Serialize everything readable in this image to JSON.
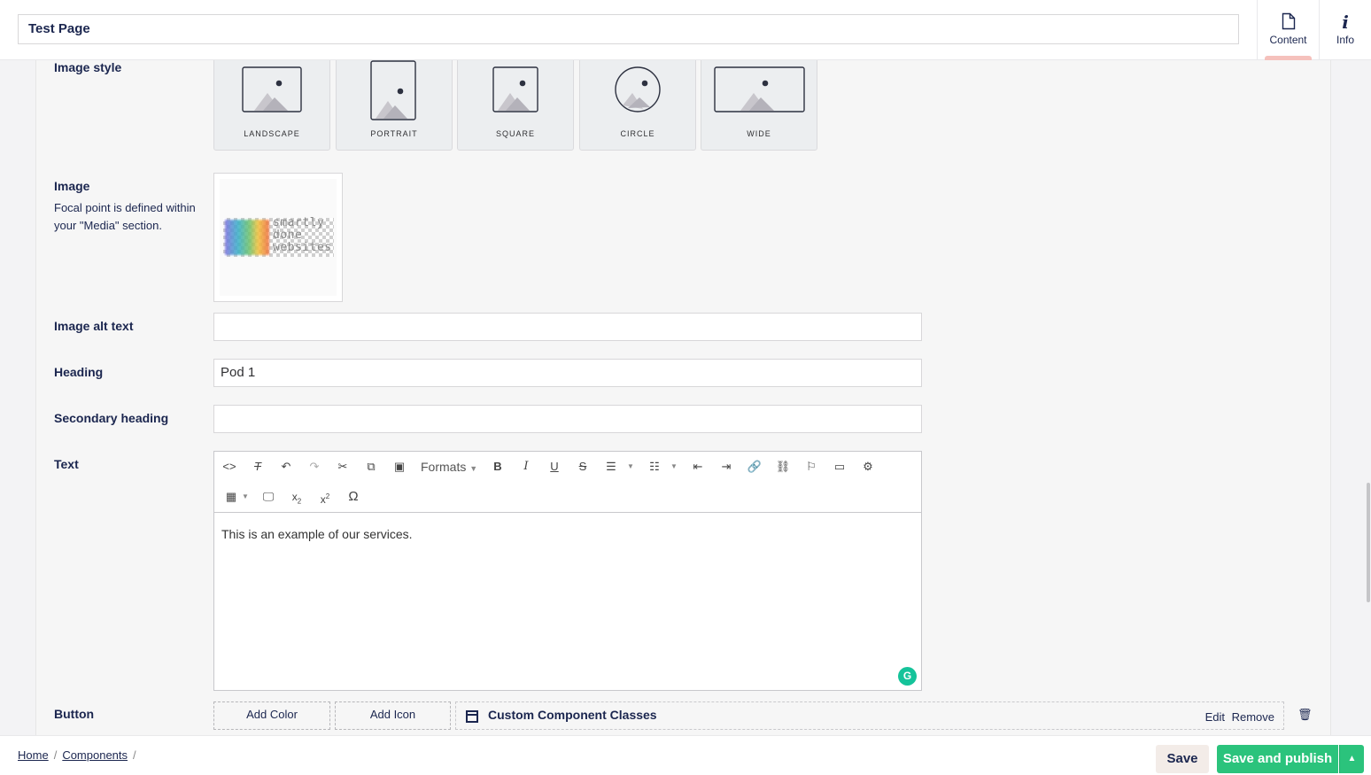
{
  "header": {
    "page_title": "Test Page",
    "tabs": [
      {
        "label": "Content",
        "icon": "document-icon",
        "active": true
      },
      {
        "label": "Info",
        "icon": "info-icon",
        "active": false
      }
    ]
  },
  "form": {
    "image_style": {
      "label": "Image style",
      "options": [
        "LANDSCAPE",
        "PORTRAIT",
        "SQUARE",
        "CIRCLE",
        "WIDE"
      ]
    },
    "image": {
      "label": "Image",
      "description": "Focal point is defined within your \"Media\" section.",
      "logo_text_lines": [
        "smartly",
        "done",
        "websites"
      ]
    },
    "image_alt_text": {
      "label": "Image alt text",
      "value": ""
    },
    "heading": {
      "label": "Heading",
      "value": "Pod 1"
    },
    "secondary_heading": {
      "label": "Secondary heading",
      "value": ""
    },
    "text": {
      "label": "Text",
      "formats_label": "Formats",
      "content": "This is an example of our services."
    },
    "button": {
      "label": "Button",
      "add_color": "Add Color",
      "add_icon": "Add Icon",
      "custom_component_title": "Custom Component Classes",
      "edit": "Edit",
      "remove": "Remove"
    }
  },
  "footer": {
    "breadcrumbs": [
      "Home",
      "Components"
    ],
    "save": "Save",
    "save_and_publish": "Save and publish"
  },
  "colors": {
    "accent_primary": "#2bc37c",
    "text_primary": "#1b264f",
    "active_tab_indicator": "#f5c1bc"
  }
}
